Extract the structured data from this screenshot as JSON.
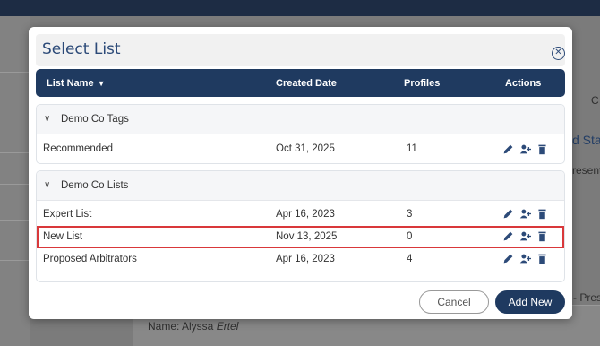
{
  "modal": {
    "title": "Select List",
    "close_icon": "close-circle-icon"
  },
  "table": {
    "headers": {
      "list_name": "List Name",
      "created_date": "Created Date",
      "profiles": "Profiles",
      "actions": "Actions"
    },
    "sort_indicator": "▼"
  },
  "groups": [
    {
      "name": "Demo Co Tags",
      "rows": [
        {
          "name": "Recommended",
          "created": "Oct 31, 2025",
          "profiles": "11"
        }
      ]
    },
    {
      "name": "Demo Co Lists",
      "rows": [
        {
          "name": "Expert List",
          "created": "Apr 16, 2023",
          "profiles": "3"
        },
        {
          "name": "New List",
          "created": "Nov 13, 2025",
          "profiles": "0"
        },
        {
          "name": "Proposed Arbitrators",
          "created": "Apr 16, 2023",
          "profiles": "4"
        }
      ]
    }
  ],
  "highlighted_row": "New List",
  "footer": {
    "cancel_label": "Cancel",
    "add_label": "Add New"
  },
  "background": {
    "fragment_1": "d Sta",
    "fragment_2": "resent",
    "fragment_3": "- Pres",
    "fragment_c": "C",
    "name_label": "Name: Alyssa ",
    "name_italic": "Ertel"
  },
  "colors": {
    "primary": "#1f3a60",
    "title": "#2c4a78",
    "highlight": "#d9383a"
  }
}
